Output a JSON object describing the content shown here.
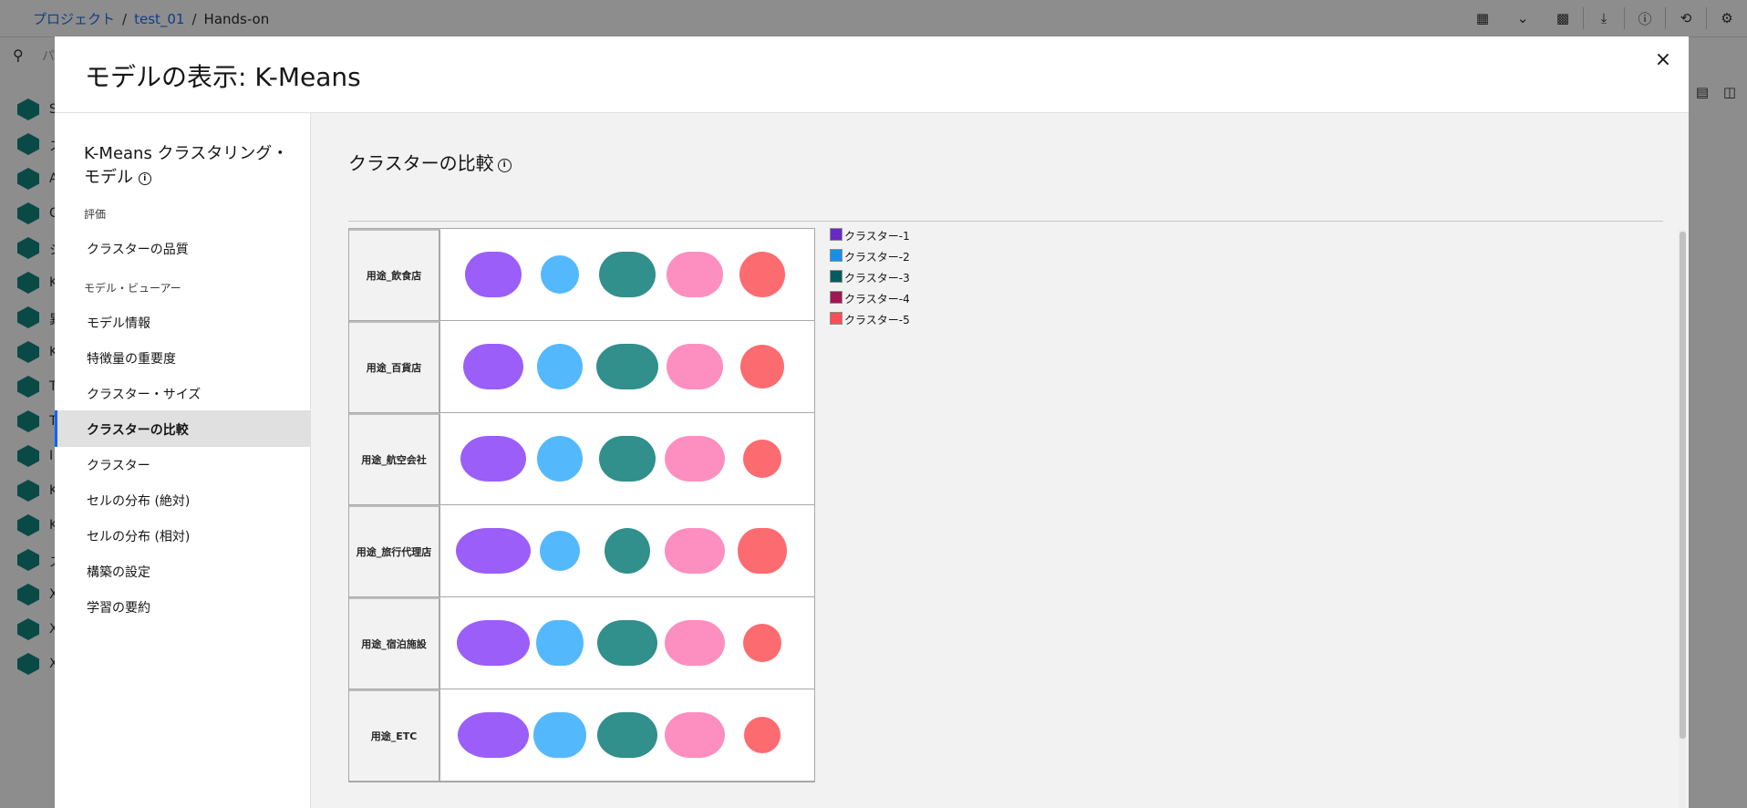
{
  "breadcrumb": {
    "project": "プロジェクト",
    "name": "test_01",
    "flow": "Hands-on"
  },
  "search": {
    "placeholder": "パ"
  },
  "background_sidebar": [
    {
      "icon": "model-node-icon",
      "text": "S"
    },
    {
      "icon": "model-node-icon",
      "text": "ス\nハ"
    },
    {
      "icon": "model-node-icon",
      "text": "A"
    },
    {
      "icon": "model-node-icon",
      "text": "C"
    },
    {
      "icon": "model-node-icon",
      "text": "シ"
    },
    {
      "icon": "model-node-icon",
      "text": "K"
    },
    {
      "icon": "model-node-icon",
      "text": "異"
    },
    {
      "icon": "model-node-icon",
      "text": "K"
    },
    {
      "icon": "model-node-icon",
      "text": "T"
    },
    {
      "icon": "model-node-icon",
      "text": "T"
    },
    {
      "icon": "model-node-icon",
      "text": "I"
    },
    {
      "icon": "model-node-icon",
      "text": "K"
    },
    {
      "icon": "model-node-icon",
      "text": "K"
    },
    {
      "icon": "model-node-icon",
      "text": "ス"
    },
    {
      "icon": "model-node-icon",
      "text": "X"
    },
    {
      "icon": "model-node-icon",
      "text": "X"
    },
    {
      "icon": "model-node-icon",
      "text": "X"
    }
  ],
  "modal": {
    "title": "モデルの表示: K-Means",
    "close_label": "×",
    "nav_heading": "K-Means クラスタリング・モデル",
    "sections": [
      {
        "label": "評価",
        "items": [
          {
            "label": "クラスターの品質"
          }
        ]
      },
      {
        "label": "モデル・ビューアー",
        "items": [
          {
            "label": "モデル情報"
          },
          {
            "label": "特徴量の重要度"
          },
          {
            "label": "クラスター・サイズ"
          },
          {
            "label": "クラスターの比較",
            "active": true
          },
          {
            "label": "クラスター"
          },
          {
            "label": "セルの分布 (絶対)"
          },
          {
            "label": "セルの分布 (相対)"
          },
          {
            "label": "構築の設定"
          },
          {
            "label": "学習の要約"
          }
        ]
      }
    ],
    "content_title": "クラスターの比較"
  },
  "colors": {
    "cluster_1": "#9b5ef8",
    "cluster_2": "#54b8fc",
    "cluster_3": "#318f8c",
    "cluster_4": "#fc8fc0",
    "cluster_5": "#fc6b70",
    "legend_1": "#6929c4",
    "legend_2": "#1192e8",
    "legend_3": "#005d5d",
    "legend_4": "#9f1853",
    "legend_5": "#fa4d56",
    "accent": "#0f62fe"
  },
  "comparison": {
    "legend": [
      "クラスター-1",
      "クラスター-2",
      "クラスター-3",
      "クラスター-4",
      "クラスター-5"
    ],
    "rows": [
      {
        "feature": "用途_飲食店"
      },
      {
        "feature": "用途_百貨店"
      },
      {
        "feature": "用途_航空会社"
      },
      {
        "feature": "用途_旅行代理店"
      },
      {
        "feature": "用途_宿泊施設"
      },
      {
        "feature": "用途_ETC"
      }
    ]
  }
}
